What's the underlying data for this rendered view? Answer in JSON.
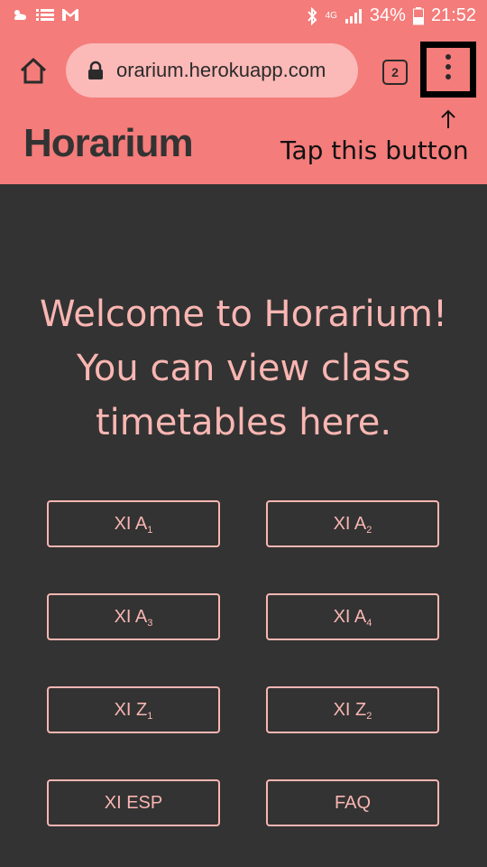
{
  "statusbar": {
    "icons_left": [
      "weather-icon",
      "list-icon",
      "gmail-icon"
    ],
    "icons_right": [
      "bluetooth-icon",
      "4g-icon",
      "signal-icon"
    ],
    "network": "4G",
    "battery": "34%",
    "time": "21:52"
  },
  "browser": {
    "url": "orarium.herokuapp.com",
    "tab_count": "2"
  },
  "site": {
    "brand": "Horarium",
    "hint": "Tap this button",
    "hint_arrow": "↑",
    "welcome_lines": [
      "Welcome to Horarium!",
      "You can view class",
      "timetables here."
    ]
  },
  "buttons": [
    {
      "main": "XI A",
      "sub": "1"
    },
    {
      "main": "XI A",
      "sub": "2"
    },
    {
      "main": "XI A",
      "sub": "3"
    },
    {
      "main": "XI A",
      "sub": "4"
    },
    {
      "main": "XI Z",
      "sub": "1"
    },
    {
      "main": "XI Z",
      "sub": "2"
    },
    {
      "main": "XI ESP",
      "sub": ""
    },
    {
      "main": "FAQ",
      "sub": ""
    }
  ],
  "colors": {
    "accent": "#f47c7a",
    "background": "#333333",
    "text_pink": "#f9b6b2"
  }
}
